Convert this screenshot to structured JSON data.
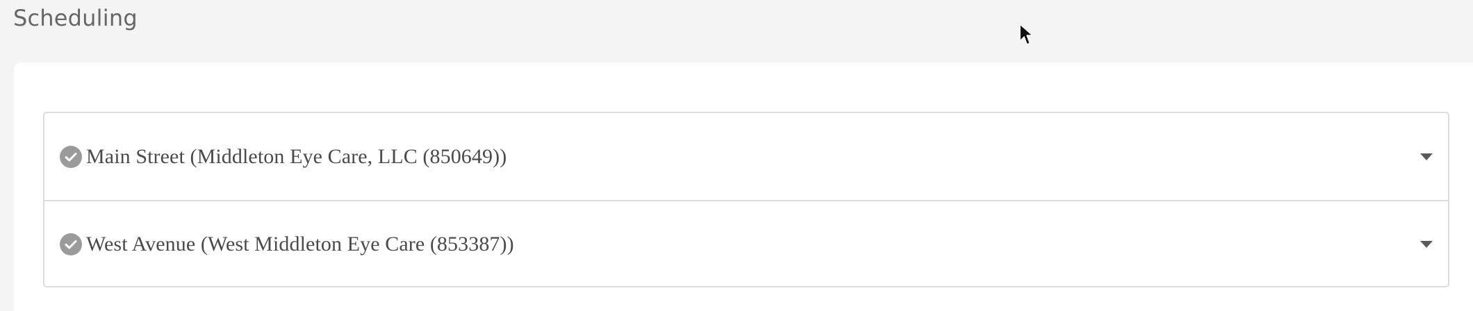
{
  "page": {
    "title": "Scheduling"
  },
  "locations": [
    {
      "label": "Main Street (Middleton Eye Care, LLC (850649))",
      "status_icon": "check-circle-icon",
      "toggle_icon": "caret-down-icon"
    },
    {
      "label": "West Avenue (West Middleton Eye Care (853387))",
      "status_icon": "check-circle-icon",
      "toggle_icon": "caret-down-icon"
    }
  ],
  "colors": {
    "background": "#f4f4f4",
    "card": "#ffffff",
    "border": "#dcdcdc",
    "icon": "#9b9b9b",
    "text": "#4a4a4a",
    "title": "#666666"
  }
}
